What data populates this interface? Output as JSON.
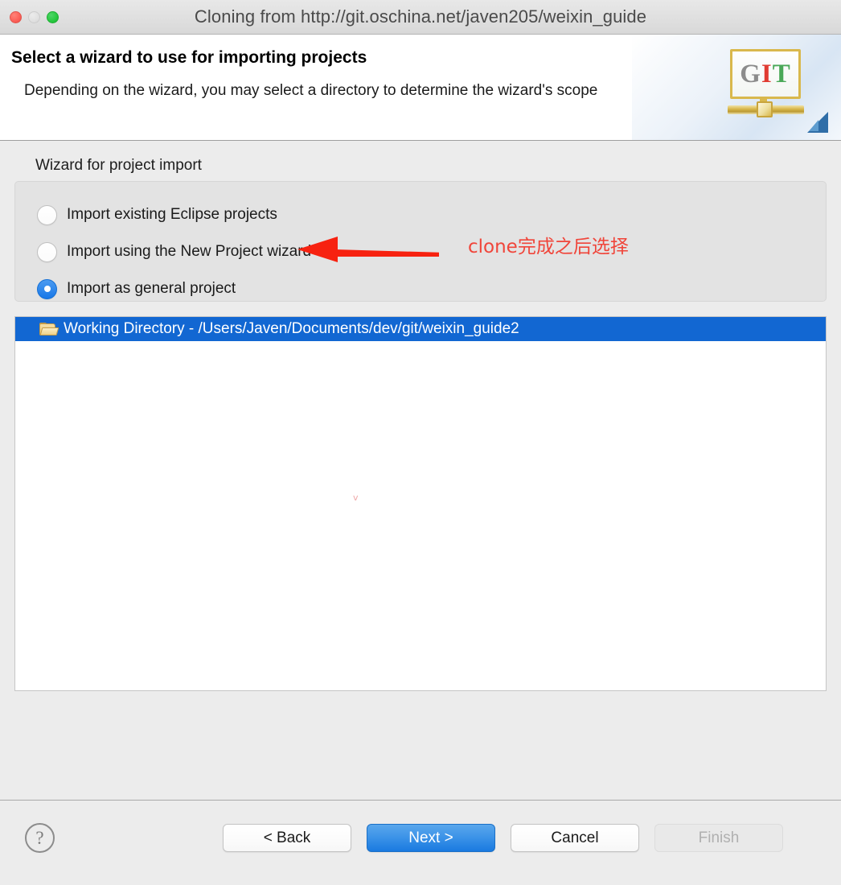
{
  "window": {
    "title": "Cloning from http://git.oschina.net/javen205/weixin_guide",
    "traffic_lights": {
      "close": "close-button",
      "minimize": "minimize-button",
      "maximize": "maximize-button"
    }
  },
  "banner": {
    "title": "Select a wizard to use for importing projects",
    "subtitle": "Depending on the wizard, you may select a directory to determine the wizard's scope",
    "logo": {
      "letter_g": "G",
      "letter_i": "I",
      "letter_t": "T",
      "name": "git-logo"
    }
  },
  "wizard_group": {
    "label": "Wizard for project import",
    "options": [
      {
        "label": "Import existing Eclipse projects",
        "selected": false
      },
      {
        "label": "Import using the New Project wizard",
        "selected": false
      },
      {
        "label": "Import as general project",
        "selected": true
      }
    ]
  },
  "annotation": {
    "text": "clone完成之后选择",
    "color": "#f0453a",
    "arrow": "left-arrow"
  },
  "file_list": {
    "rows": [
      {
        "label": "Working Directory - /Users/Javen/Documents/dev/git/weixin_guide2",
        "icon": "open-folder-icon",
        "selected": true
      }
    ],
    "selection_color": "#1267d2",
    "watermark": "v"
  },
  "footer": {
    "help_label": "?",
    "buttons": [
      {
        "label": "< Back",
        "state": "enabled",
        "name": "back-button"
      },
      {
        "label": "Next >",
        "state": "default",
        "name": "next-button"
      },
      {
        "label": "Cancel",
        "state": "enabled",
        "name": "cancel-button"
      },
      {
        "label": "Finish",
        "state": "disabled",
        "name": "finish-button"
      }
    ]
  }
}
